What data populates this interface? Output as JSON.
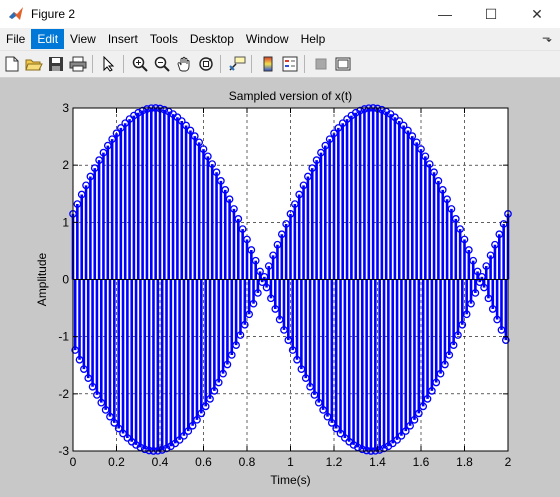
{
  "window": {
    "title": "Figure 2",
    "controls": {
      "minimize": "—",
      "maximize": "☐",
      "close": "✕"
    }
  },
  "menu": {
    "items": [
      {
        "label": "File"
      },
      {
        "label": "Edit"
      },
      {
        "label": "View"
      },
      {
        "label": "Insert"
      },
      {
        "label": "Tools"
      },
      {
        "label": "Desktop"
      },
      {
        "label": "Window"
      },
      {
        "label": "Help"
      }
    ],
    "active_index": 1,
    "overflow_arrow": "⬎"
  },
  "toolbar": {
    "buttons": [
      {
        "icon": "new-file-icon"
      },
      {
        "icon": "open-folder-icon"
      },
      {
        "icon": "save-icon"
      },
      {
        "icon": "print-icon"
      },
      {
        "icon": "select-pointer-icon"
      },
      {
        "icon": "zoom-in-icon"
      },
      {
        "icon": "zoom-out-icon"
      },
      {
        "icon": "pan-hand-icon"
      },
      {
        "icon": "rotate-3d-icon"
      },
      {
        "icon": "data-cursor-icon"
      },
      {
        "icon": "colorbar-icon"
      },
      {
        "icon": "legend-icon"
      },
      {
        "icon": "hide-plot-tools-icon"
      },
      {
        "icon": "show-plot-tools-icon"
      }
    ]
  },
  "colors": {
    "stem": "#0000ff",
    "axes_bg": "#ffffff",
    "figure_bg": "#c8c8c8",
    "active_menu": "#0078d7"
  },
  "chart_data": {
    "type": "stem",
    "title": "Sampled version of x(t)",
    "xlabel": "Time(s)",
    "ylabel": "Amplitude",
    "xlim": [
      0,
      2
    ],
    "ylim": [
      -3,
      3
    ],
    "xticks": [
      "0",
      "0.2",
      "0.4",
      "0.6",
      "0.8",
      "1",
      "1.2",
      "1.4",
      "1.6",
      "1.8",
      "2"
    ],
    "yticks": [
      "3",
      "2",
      "1",
      "0",
      "-1",
      "-2",
      "-3"
    ],
    "grid": "dashed",
    "series": [
      {
        "color": "#0000ff",
        "marker": "circle",
        "envelope": "3*|sin(pi*(t+0.125))|",
        "approx_samples": 200
      }
    ]
  }
}
